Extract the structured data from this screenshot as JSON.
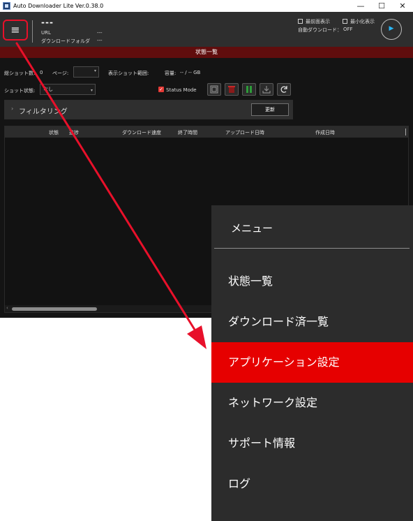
{
  "window": {
    "title": "Auto Downloader Lite Ver.0.38.0",
    "minimize_glyph": "—",
    "maximize_glyph": "☐",
    "close_glyph": "✕"
  },
  "header": {
    "menu_glyph": "≡",
    "title": "---",
    "url_label": "URL",
    "url_value": "---",
    "folder_label": "ダウンロードフォルダ",
    "folder_value": "---",
    "always_on_top_label": "最前面表示",
    "minimize_display_label": "最小化表示",
    "auto_download_label": "自動ダウンロード：",
    "auto_download_value": "OFF",
    "play_glyph": "▶"
  },
  "status_bar": {
    "title": "状態一覧"
  },
  "controls": {
    "total_shots_label": "総ショット数:",
    "total_shots_value": "0",
    "page_label": "ページ:",
    "page_value": "",
    "display_range_label": "表示ショット範囲:",
    "capacity_label": "容量:",
    "capacity_value": "-- / -- GB",
    "shot_status_label": "ショット状態:",
    "shot_status_value": "なし",
    "status_mode_label": "Status Mode",
    "status_mode_checked": true,
    "toolbar_icons": [
      "film-icon",
      "delete-icon",
      "pause-icon",
      "download-icon",
      "refresh-icon"
    ]
  },
  "filter": {
    "chevron_glyph": "›",
    "label": "フィルタリング",
    "update_label": "更新"
  },
  "table": {
    "columns": [
      "状態",
      "進捗",
      "ダウンロード速度",
      "終了時間",
      "アップロード日時",
      "作成日時"
    ],
    "rows": []
  },
  "menu": {
    "title": "メニュー",
    "items": [
      {
        "label": "状態一覧",
        "active": false
      },
      {
        "label": "ダウンロード済一覧",
        "active": false
      },
      {
        "label": "アプリケーション設定",
        "active": true
      },
      {
        "label": "ネットワーク設定",
        "active": false
      },
      {
        "label": "サポート情報",
        "active": false
      },
      {
        "label": "ログ",
        "active": false
      }
    ]
  },
  "colors": {
    "accent_red": "#e60000",
    "status_bar": "#600d0d",
    "annotation": "#e8102a",
    "play_icon": "#29b6f6"
  }
}
